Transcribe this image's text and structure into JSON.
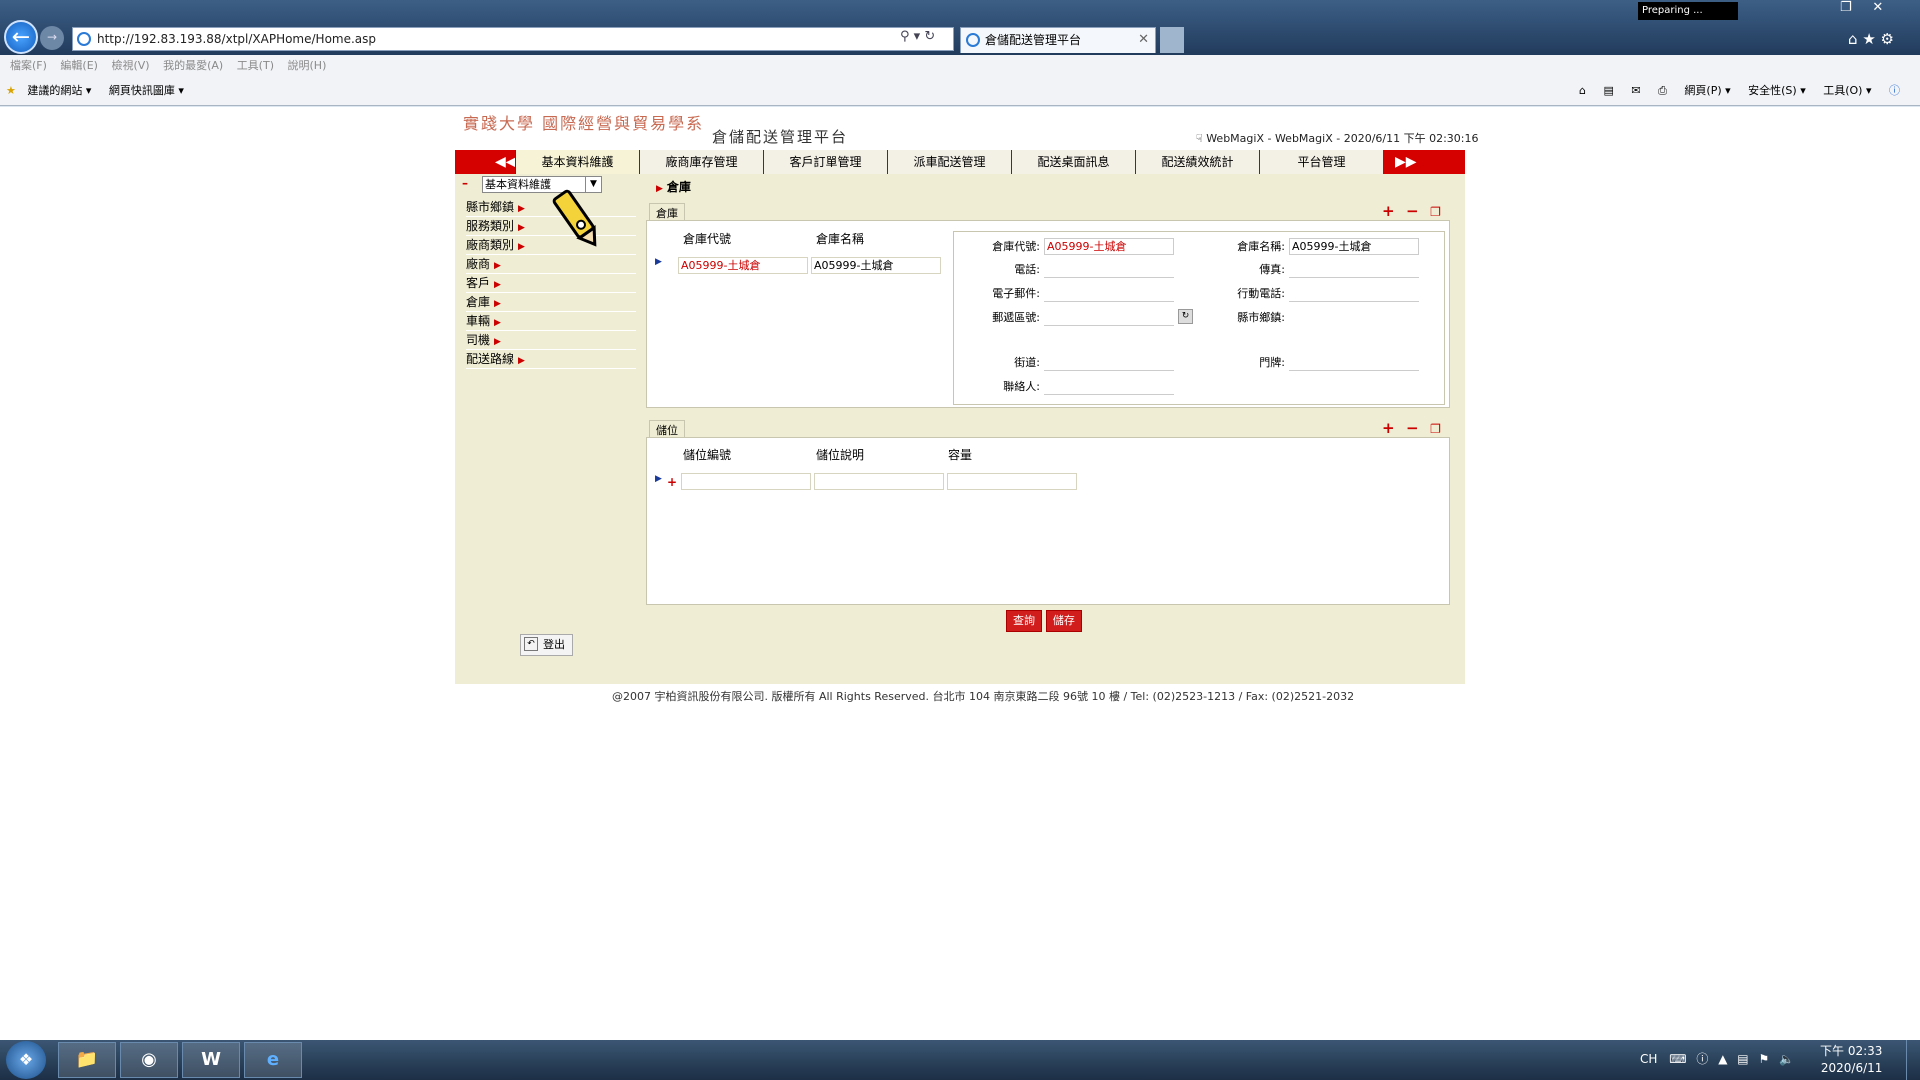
{
  "browser": {
    "url": "http://192.83.193.88/xtpl/XAPHome/Home.asp",
    "tab_title": "倉儲配送管理平台",
    "menu": [
      "檔案(F)",
      "編輯(E)",
      "檢視(V)",
      "我的最愛(A)",
      "工具(T)",
      "說明(H)"
    ],
    "favorites": [
      "建議的網站 ▾",
      "網頁快訊圖庫 ▾"
    ],
    "commands": [
      "網頁(P) ▾",
      "安全性(S) ▾",
      "工具(O) ▾"
    ],
    "status_badge": "Preparing ..."
  },
  "header": {
    "school": "實踐大學 國際經營與貿易學系",
    "title": "倉儲配送管理平台",
    "info": "WebMagiX - WebMagiX - 2020/6/11 下午 02:30:16"
  },
  "nav": {
    "tabs": [
      "基本資料維護",
      "廠商庫存管理",
      "客戶訂單管理",
      "派車配送管理",
      "配送桌面訊息",
      "配送績效統計",
      "平台管理"
    ]
  },
  "sidebar": {
    "select_value": "基本資料維護",
    "items": [
      "縣市鄉鎮",
      "服務類別",
      "廠商類別",
      "廠商",
      "客戶",
      "倉庫",
      "車輛",
      "司機",
      "配送路線"
    ],
    "logout": "登出"
  },
  "breadcrumb": "倉庫",
  "warehouse": {
    "panel_label": "倉庫",
    "columns": [
      "倉庫代號",
      "倉庫名稱"
    ],
    "rows": [
      {
        "code": "A05999-土城倉",
        "name": "A05999-土城倉"
      }
    ],
    "form": {
      "code_label": "倉庫代號:",
      "code_value": "A05999-土城倉",
      "name_label": "倉庫名稱:",
      "name_value": "A05999-土城倉",
      "phone_label": "電話:",
      "fax_label": "傳真:",
      "email_label": "電子郵件:",
      "mobile_label": "行動電話:",
      "zip_label": "郵遞區號:",
      "district_label": "縣市鄉鎮:",
      "street_label": "街道:",
      "number_label": "門牌:",
      "contact_label": "聯絡人:"
    }
  },
  "storage": {
    "panel_label": "儲位",
    "columns": [
      "儲位編號",
      "儲位說明",
      "容量"
    ]
  },
  "actions": {
    "query": "查詢",
    "save": "儲存"
  },
  "footer": "@2007 宇柏資訊股份有限公司. 版權所有 All Rights Reserved. 台北市 104 南京東路二段 96號 10 樓 / Tel: (02)2523-1213 / Fax: (02)2521-2032",
  "taskbar": {
    "lang": "CH",
    "time": "下午 02:33",
    "date": "2020/6/11"
  },
  "colors": {
    "accent": "#d50000",
    "content_bg": "#efedd3",
    "school_text": "#c86a52"
  }
}
